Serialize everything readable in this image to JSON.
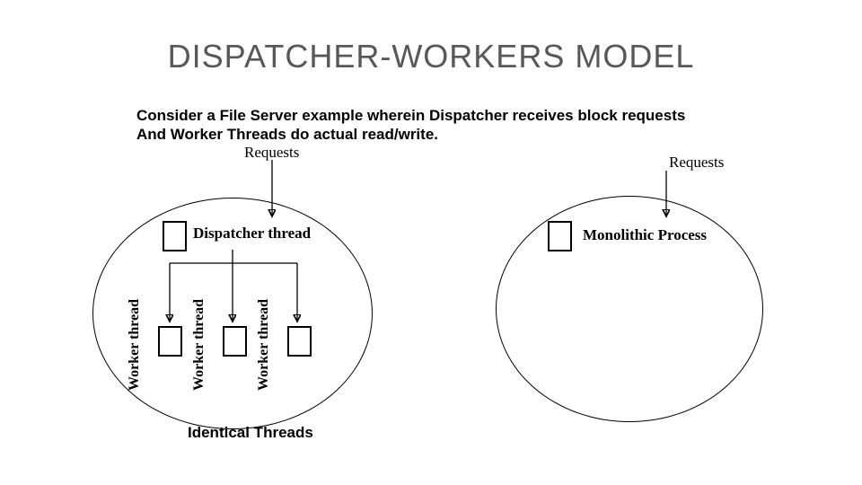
{
  "title": "DISPATCHER-WORKERS MODEL",
  "description_line1": "Consider a File Server example wherein Dispatcher receives block  requests",
  "description_line2": "And Worker Threads do actual read/write.",
  "labels": {
    "requests": "Requests",
    "dispatcher_thread": "Dispatcher thread",
    "monolithic_process": "Monolithic Process",
    "worker_thread": "Worker thread",
    "identical_threads": "Identical Threads"
  }
}
